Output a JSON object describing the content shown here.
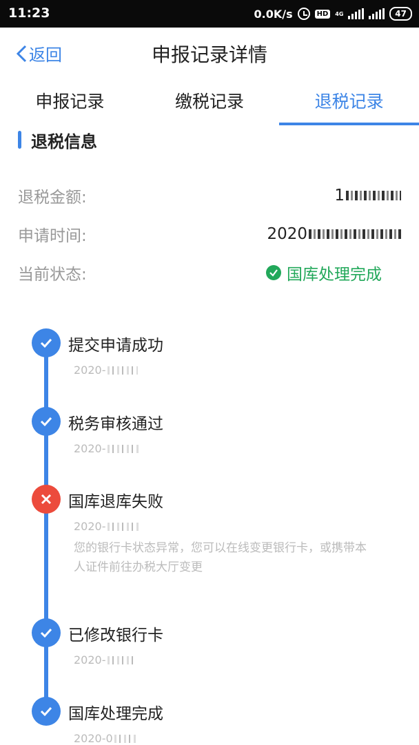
{
  "statusbar": {
    "time": "11:23",
    "speed": "0.0K/s",
    "hd": "HD",
    "network": "4G",
    "battery": "47"
  },
  "header": {
    "back_label": "返回",
    "title": "申报记录详情"
  },
  "tabs": [
    {
      "label": "申报记录",
      "active": false
    },
    {
      "label": "缴税记录",
      "active": false
    },
    {
      "label": "退税记录",
      "active": true
    }
  ],
  "section": {
    "title": "退税信息"
  },
  "info": {
    "amount": {
      "label": "退税金额:",
      "value": "1"
    },
    "time": {
      "label": "申请时间:",
      "value": "2020"
    },
    "status": {
      "label": "当前状态:",
      "value": "国库处理完成"
    }
  },
  "timeline": [
    {
      "title": "提交申请成功",
      "date": "2020-",
      "state": "ok"
    },
    {
      "title": "税务审核通过",
      "date": "2020-",
      "state": "ok"
    },
    {
      "title": "国库退库失败",
      "date": "2020-",
      "state": "fail",
      "note": "您的银行卡状态异常，您可以在线变更银行卡，或携带本人证件前往办税大厅变更"
    },
    {
      "title": "已修改银行卡",
      "date": "2020-",
      "state": "ok"
    },
    {
      "title": "国库处理完成",
      "date": "2020-0",
      "state": "ok"
    }
  ],
  "colors": {
    "accent": "#3d85e6",
    "success": "#22a85a",
    "error": "#ec4b3c"
  }
}
